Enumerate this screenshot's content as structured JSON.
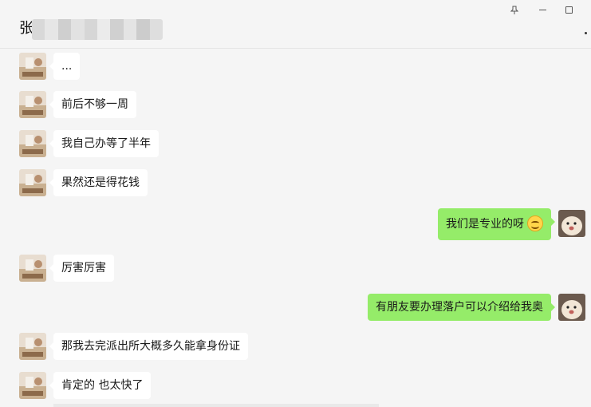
{
  "header": {
    "title": "张",
    "icons": [
      "pin-icon",
      "minimize-icon",
      "maximize-icon",
      "more-icon"
    ],
    "redacted_colors": [
      "#d8d8d8",
      "#e6e6e6",
      "#cfcfcf",
      "#e2e2e2",
      "#d6d6d6",
      "#ebebeb",
      "#d0d0d0",
      "#e4e4e4",
      "#cccccc",
      "#dedede"
    ]
  },
  "messages": [
    {
      "side": "left",
      "text": "..."
    },
    {
      "side": "left",
      "text": "前后不够一周"
    },
    {
      "side": "left",
      "text": "我自己办等了半年"
    },
    {
      "side": "left",
      "text": "果然还是得花钱"
    },
    {
      "side": "right",
      "text": "我们是专业的呀",
      "emoji": "smiling-face-icon"
    },
    {
      "side": "left",
      "text": "厉害厉害"
    },
    {
      "side": "right",
      "text": "有朋友要办理落户可以介绍给我奥"
    },
    {
      "side": "left",
      "text": "那我去完派出所大概多久能拿身份证"
    },
    {
      "side": "left",
      "text": "肯定的 也太快了"
    }
  ],
  "colors": {
    "background": "#f5f5f5",
    "bubble_left": "#ffffff",
    "bubble_right": "#95ec69"
  }
}
